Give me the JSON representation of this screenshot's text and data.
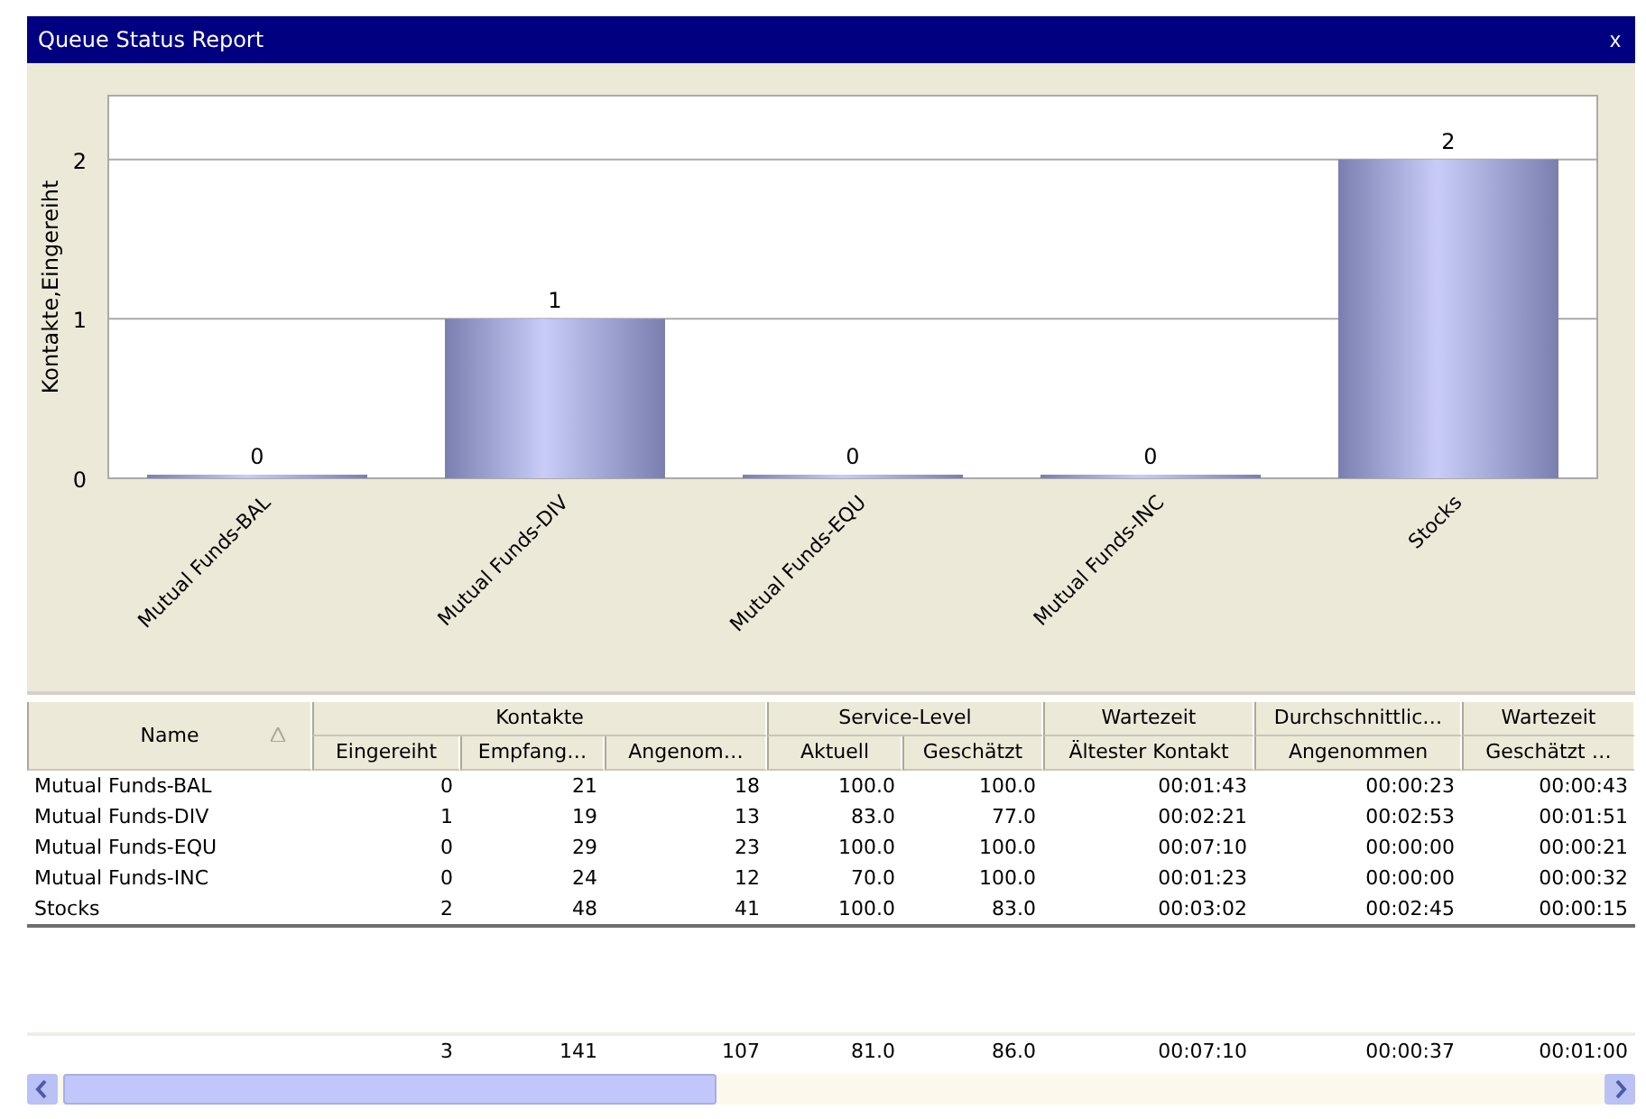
{
  "window": {
    "title": "Queue Status Report",
    "close": "x"
  },
  "chart": {
    "chart_data": {
      "type": "bar",
      "ylabel": "Kontakte,Eingereiht",
      "categories": [
        "Mutual Funds-BAL",
        "Mutual Funds-DIV",
        "Mutual Funds-EQU",
        "Mutual Funds-INC",
        "Stocks"
      ],
      "values": [
        0,
        1,
        0,
        0,
        2
      ],
      "ylim": [
        0,
        2.4
      ],
      "yticks": [
        0,
        1,
        2
      ],
      "data_labels": true
    }
  },
  "table": {
    "name_header": {
      "label": "Name",
      "sorted_ascending": true
    },
    "column_groups": [
      {
        "label": "Kontakte",
        "columns": [
          "Eingereiht",
          "Empfang…",
          "Angenom…"
        ]
      },
      {
        "label": "Service-Level",
        "columns": [
          "Aktuell",
          "Geschätzt"
        ]
      },
      {
        "label": "Wartezeit",
        "columns": [
          "Ältester Kontakt"
        ]
      },
      {
        "label": "Durchschnittlic…",
        "columns": [
          "Angenommen"
        ]
      },
      {
        "label": "Wartezeit",
        "columns": [
          "Geschätzt …"
        ]
      }
    ],
    "rows": [
      [
        "Mutual Funds-BAL",
        "0",
        "21",
        "18",
        "100.0",
        "100.0",
        "00:01:43",
        "00:00:23",
        "00:00:43"
      ],
      [
        "Mutual Funds-DIV",
        "1",
        "19",
        "13",
        "83.0",
        "77.0",
        "00:02:21",
        "00:02:53",
        "00:01:51"
      ],
      [
        "Mutual Funds-EQU",
        "0",
        "29",
        "23",
        "100.0",
        "100.0",
        "00:07:10",
        "00:00:00",
        "00:00:21"
      ],
      [
        "Mutual Funds-INC",
        "0",
        "24",
        "12",
        "70.0",
        "100.0",
        "00:01:23",
        "00:00:00",
        "00:00:32"
      ],
      [
        "Stocks",
        "2",
        "48",
        "41",
        "100.0",
        "83.0",
        "00:03:02",
        "00:02:45",
        "00:00:15"
      ]
    ],
    "totals": [
      "3",
      "141",
      "107",
      "81.0",
      "86.0",
      "00:07:10",
      "00:00:37",
      "00:01:00"
    ]
  }
}
